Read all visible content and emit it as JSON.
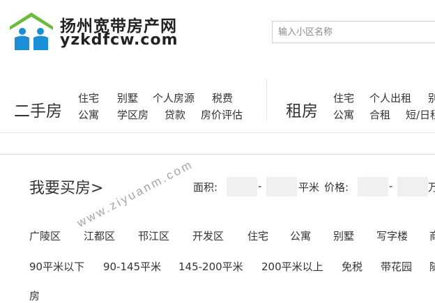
{
  "brand": {
    "name_cn": "扬州宽带房产网",
    "domain": "yzkdfcw.com",
    "colors": {
      "house": "#6cbc3c",
      "people": "#1a8fd6"
    }
  },
  "search": {
    "placeholder": "输入小区名称"
  },
  "nav": {
    "secondhand": {
      "title": "二手房",
      "row1": [
        "住宅",
        "别墅",
        "个人房源",
        "税费"
      ],
      "row2": [
        "公寓",
        "学区房",
        "贷款",
        "房价评估"
      ]
    },
    "rent": {
      "title": "租房",
      "row1": [
        "住宅",
        "个人出租",
        "别"
      ],
      "row2": [
        "公寓",
        "合租",
        "短/日租"
      ]
    }
  },
  "buy": {
    "title": "我要买房>",
    "area_label": "面积:",
    "dash": "-",
    "area_unit": "平米",
    "price_label": "价格:",
    "price_unit": "万",
    "filters_row1": [
      "广陵区",
      "江都区",
      "邗江区",
      "开发区",
      "住宅",
      "公寓",
      "别墅",
      "写字楼",
      "商"
    ],
    "filters_row2": [
      "90平米以下",
      "90-145平米",
      "145-200平米",
      "200平米以上",
      "免税",
      "带花园",
      "随"
    ],
    "row3_partial": "房"
  },
  "watermark": "www.ziyuanm.com"
}
